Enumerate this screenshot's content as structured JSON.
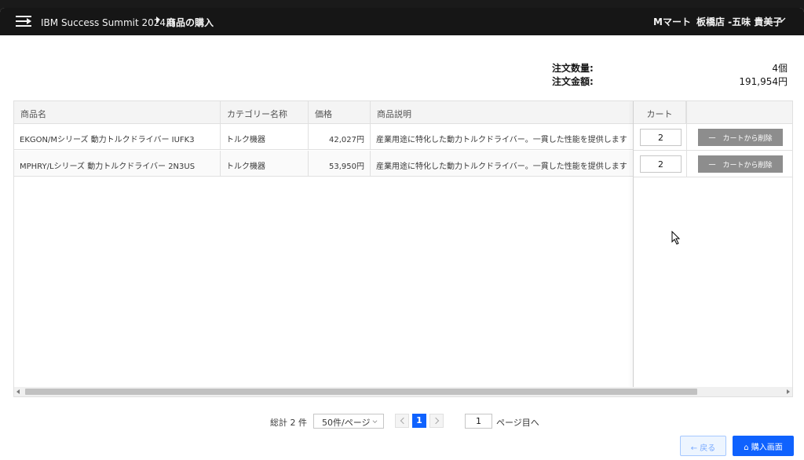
{
  "header": {
    "app_name": "IBM Success Summit 2024用",
    "page_name": "商品の購入",
    "store": "Mマート",
    "user": "板橋店 -五味 貴美子"
  },
  "summary": {
    "qty_label": "注文数量:",
    "qty_value": "4個",
    "amount_label": "注文金額:",
    "amount_value": "191,954円"
  },
  "table": {
    "columns": [
      "商品名",
      "カテゴリー名称",
      "価格",
      "商品説明",
      "カート",
      ""
    ],
    "rows": [
      {
        "name": "EKGON/Mシリーズ 動力トルクドライバー IUFK3",
        "category": "トルク機器",
        "price": "42,027円",
        "description": "産業用途に特化した動力トルクドライバー。一貫した性能を提供します",
        "qty": "2",
        "remove_label": "一　カートから削除"
      },
      {
        "name": "MPHRY/Lシリーズ 動力トルクドライバー 2N3US",
        "category": "トルク機器",
        "price": "53,950円",
        "description": "産業用途に特化した動力トルクドライバー。一貫した性能を提供します",
        "qty": "2",
        "remove_label": "一　カートから削除"
      }
    ]
  },
  "pagination": {
    "total": "総計 2 件",
    "per_page": "50件/ページ",
    "current_page": "1",
    "goto_value": "1",
    "goto_label": "ページ目へ"
  },
  "actions": {
    "back_label": "← 戻る",
    "buy_label": "⌂ 購入画面"
  },
  "colors": {
    "topbar": "#161616",
    "primary": "#0f62fe",
    "remove_button": "#8d8d8d"
  }
}
